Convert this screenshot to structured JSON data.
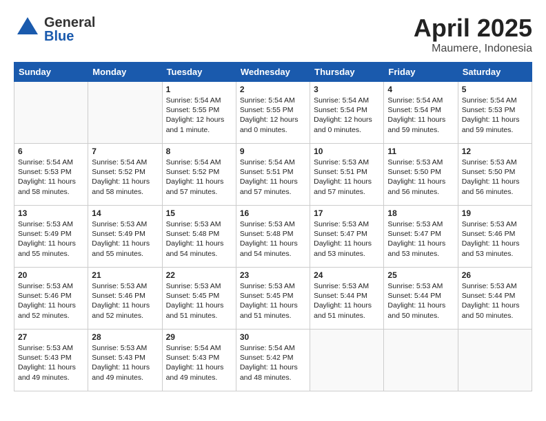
{
  "header": {
    "logo_general": "General",
    "logo_blue": "Blue",
    "title": "April 2025",
    "subtitle": "Maumere, Indonesia"
  },
  "columns": [
    "Sunday",
    "Monday",
    "Tuesday",
    "Wednesday",
    "Thursday",
    "Friday",
    "Saturday"
  ],
  "weeks": [
    [
      {
        "day": "",
        "info": ""
      },
      {
        "day": "",
        "info": ""
      },
      {
        "day": "1",
        "info": "Sunrise: 5:54 AM\nSunset: 5:55 PM\nDaylight: 12 hours\nand 1 minute."
      },
      {
        "day": "2",
        "info": "Sunrise: 5:54 AM\nSunset: 5:55 PM\nDaylight: 12 hours\nand 0 minutes."
      },
      {
        "day": "3",
        "info": "Sunrise: 5:54 AM\nSunset: 5:54 PM\nDaylight: 12 hours\nand 0 minutes."
      },
      {
        "day": "4",
        "info": "Sunrise: 5:54 AM\nSunset: 5:54 PM\nDaylight: 11 hours\nand 59 minutes."
      },
      {
        "day": "5",
        "info": "Sunrise: 5:54 AM\nSunset: 5:53 PM\nDaylight: 11 hours\nand 59 minutes."
      }
    ],
    [
      {
        "day": "6",
        "info": "Sunrise: 5:54 AM\nSunset: 5:53 PM\nDaylight: 11 hours\nand 58 minutes."
      },
      {
        "day": "7",
        "info": "Sunrise: 5:54 AM\nSunset: 5:52 PM\nDaylight: 11 hours\nand 58 minutes."
      },
      {
        "day": "8",
        "info": "Sunrise: 5:54 AM\nSunset: 5:52 PM\nDaylight: 11 hours\nand 57 minutes."
      },
      {
        "day": "9",
        "info": "Sunrise: 5:54 AM\nSunset: 5:51 PM\nDaylight: 11 hours\nand 57 minutes."
      },
      {
        "day": "10",
        "info": "Sunrise: 5:53 AM\nSunset: 5:51 PM\nDaylight: 11 hours\nand 57 minutes."
      },
      {
        "day": "11",
        "info": "Sunrise: 5:53 AM\nSunset: 5:50 PM\nDaylight: 11 hours\nand 56 minutes."
      },
      {
        "day": "12",
        "info": "Sunrise: 5:53 AM\nSunset: 5:50 PM\nDaylight: 11 hours\nand 56 minutes."
      }
    ],
    [
      {
        "day": "13",
        "info": "Sunrise: 5:53 AM\nSunset: 5:49 PM\nDaylight: 11 hours\nand 55 minutes."
      },
      {
        "day": "14",
        "info": "Sunrise: 5:53 AM\nSunset: 5:49 PM\nDaylight: 11 hours\nand 55 minutes."
      },
      {
        "day": "15",
        "info": "Sunrise: 5:53 AM\nSunset: 5:48 PM\nDaylight: 11 hours\nand 54 minutes."
      },
      {
        "day": "16",
        "info": "Sunrise: 5:53 AM\nSunset: 5:48 PM\nDaylight: 11 hours\nand 54 minutes."
      },
      {
        "day": "17",
        "info": "Sunrise: 5:53 AM\nSunset: 5:47 PM\nDaylight: 11 hours\nand 53 minutes."
      },
      {
        "day": "18",
        "info": "Sunrise: 5:53 AM\nSunset: 5:47 PM\nDaylight: 11 hours\nand 53 minutes."
      },
      {
        "day": "19",
        "info": "Sunrise: 5:53 AM\nSunset: 5:46 PM\nDaylight: 11 hours\nand 53 minutes."
      }
    ],
    [
      {
        "day": "20",
        "info": "Sunrise: 5:53 AM\nSunset: 5:46 PM\nDaylight: 11 hours\nand 52 minutes."
      },
      {
        "day": "21",
        "info": "Sunrise: 5:53 AM\nSunset: 5:46 PM\nDaylight: 11 hours\nand 52 minutes."
      },
      {
        "day": "22",
        "info": "Sunrise: 5:53 AM\nSunset: 5:45 PM\nDaylight: 11 hours\nand 51 minutes."
      },
      {
        "day": "23",
        "info": "Sunrise: 5:53 AM\nSunset: 5:45 PM\nDaylight: 11 hours\nand 51 minutes."
      },
      {
        "day": "24",
        "info": "Sunrise: 5:53 AM\nSunset: 5:44 PM\nDaylight: 11 hours\nand 51 minutes."
      },
      {
        "day": "25",
        "info": "Sunrise: 5:53 AM\nSunset: 5:44 PM\nDaylight: 11 hours\nand 50 minutes."
      },
      {
        "day": "26",
        "info": "Sunrise: 5:53 AM\nSunset: 5:44 PM\nDaylight: 11 hours\nand 50 minutes."
      }
    ],
    [
      {
        "day": "27",
        "info": "Sunrise: 5:53 AM\nSunset: 5:43 PM\nDaylight: 11 hours\nand 49 minutes."
      },
      {
        "day": "28",
        "info": "Sunrise: 5:53 AM\nSunset: 5:43 PM\nDaylight: 11 hours\nand 49 minutes."
      },
      {
        "day": "29",
        "info": "Sunrise: 5:54 AM\nSunset: 5:43 PM\nDaylight: 11 hours\nand 49 minutes."
      },
      {
        "day": "30",
        "info": "Sunrise: 5:54 AM\nSunset: 5:42 PM\nDaylight: 11 hours\nand 48 minutes."
      },
      {
        "day": "",
        "info": ""
      },
      {
        "day": "",
        "info": ""
      },
      {
        "day": "",
        "info": ""
      }
    ]
  ]
}
